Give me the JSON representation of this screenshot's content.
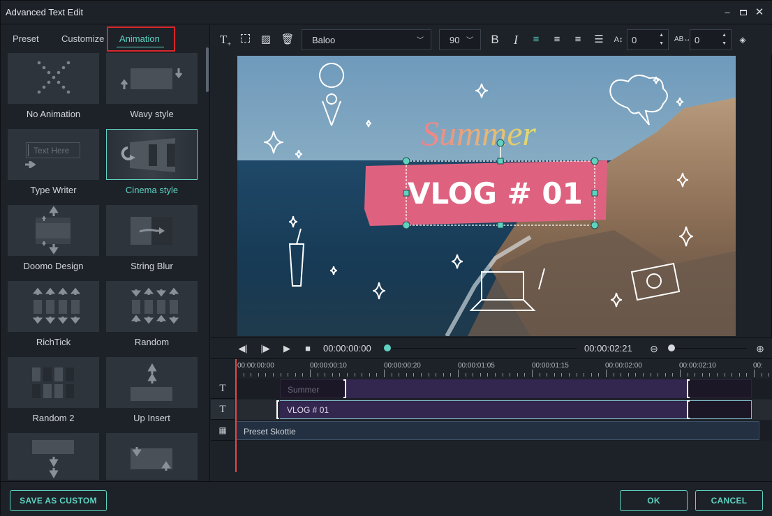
{
  "window": {
    "title": "Advanced Text Edit",
    "controls": [
      "minimize",
      "maximize",
      "close"
    ]
  },
  "tabs": [
    {
      "label": "Preset",
      "active": false
    },
    {
      "label": "Customize",
      "active": false
    },
    {
      "label": "Animation",
      "active": true
    }
  ],
  "animations": [
    {
      "label": "No Animation",
      "icon": "no-animation-icon",
      "selected": false
    },
    {
      "label": "Wavy style",
      "icon": "wavy-style-icon",
      "selected": false
    },
    {
      "label": "Type Writer",
      "icon": "type-writer-icon",
      "thumb_text": "Text Here",
      "selected": false
    },
    {
      "label": "Cinema style",
      "icon": "cinema-style-icon",
      "selected": true
    },
    {
      "label": "Doomo Design",
      "icon": "doomo-design-icon",
      "selected": false
    },
    {
      "label": "String Blur",
      "icon": "string-blur-icon",
      "selected": false
    },
    {
      "label": "RichTick",
      "icon": "richtick-icon",
      "selected": false
    },
    {
      "label": "Random",
      "icon": "random-icon",
      "selected": false
    },
    {
      "label": "Random 2",
      "icon": "random-2-icon",
      "selected": false
    },
    {
      "label": "Up Insert",
      "icon": "up-insert-icon",
      "selected": false
    },
    {
      "label": "",
      "icon": "down-insert-icon",
      "selected": false
    },
    {
      "label": "",
      "icon": "diagonal-insert-icon",
      "selected": false
    }
  ],
  "toolbar": {
    "font": "Baloo",
    "size": "90",
    "line_spacing": "0",
    "char_spacing": "0",
    "icons": [
      "add-text-icon",
      "add-shape-icon",
      "add-image-icon",
      "delete-icon",
      "bold-icon",
      "italic-icon",
      "align-left-icon",
      "align-center-icon",
      "align-right-icon",
      "justify-icon",
      "line-spacing-icon",
      "char-spacing-icon",
      "keyframe-icon"
    ]
  },
  "preview": {
    "title_text": "Summer",
    "main_text": "VLOG # 01",
    "banner_color": "#de6280",
    "selection_color": "#5fd3c1"
  },
  "playback": {
    "current_time": "00:00:00:00",
    "total_time": "00:00:02:21",
    "progress": 0.0,
    "zoom_level": 0.0
  },
  "timeline": {
    "ticks": [
      "00:00:00:00",
      "00:00:00:10",
      "00:00:00:20",
      "00:00:01:05",
      "00:00:01:15",
      "00:00:02:00",
      "00:00:02:10",
      "00:"
    ],
    "tracks": [
      {
        "type": "text",
        "icon": "text-track-icon",
        "clip": "Summer"
      },
      {
        "type": "text",
        "icon": "text-track-icon",
        "clip": "VLOG # 01"
      },
      {
        "type": "video",
        "icon": "film-track-icon",
        "clip": "Preset Skottie"
      }
    ]
  },
  "buttons": {
    "save_custom": "SAVE AS CUSTOM",
    "ok": "OK",
    "cancel": "CANCEL"
  },
  "colors": {
    "accent": "#5fd3c1",
    "highlight_box": "#d9262b",
    "playhead": "#e04848"
  }
}
